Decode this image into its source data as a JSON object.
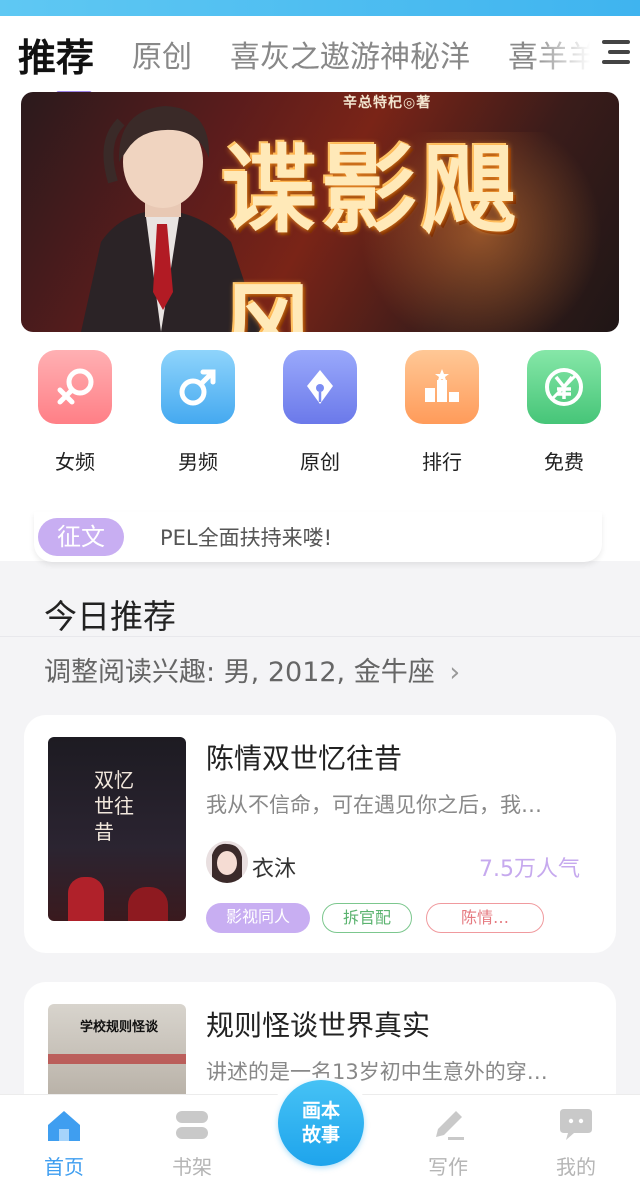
{
  "tabs": [
    {
      "label": "推荐",
      "active": true
    },
    {
      "label": "原创",
      "active": false
    },
    {
      "label": "喜灰之遨游神秘洋",
      "active": false
    },
    {
      "label": "喜羊羊",
      "active": false
    }
  ],
  "banner": {
    "author": "辛总特杞◎著",
    "title": "谍影飓风",
    "slide_count": 5,
    "active_slide": 1
  },
  "categories": [
    {
      "label": "女频",
      "icon": "female-symbol-icon",
      "color": "#ff8f93"
    },
    {
      "label": "男频",
      "icon": "male-symbol-icon",
      "color": "#54b8f3"
    },
    {
      "label": "原创",
      "icon": "pen-nib-icon",
      "color": "#7b8cf2"
    },
    {
      "label": "排行",
      "icon": "podium-icon",
      "color": "#ffb074"
    },
    {
      "label": "免费",
      "icon": "yen-free-icon",
      "color": "#5fd48d"
    }
  ],
  "notice": {
    "badge": "征文",
    "text": "PEL全面扶持来喽!"
  },
  "section": {
    "title": "今日推荐",
    "preferences": "调整阅读兴趣: 男, 2012, 金牛座"
  },
  "books": [
    {
      "title": "陈情双世忆往昔",
      "description": "我从不信命，可在遇见你之后，我…",
      "author": "衣沐",
      "popularity": "7.5万人气",
      "cover_text": "双忆世往昔",
      "tags": [
        {
          "label": "影视同人",
          "style": "filled"
        },
        {
          "label": "拆官配",
          "style": "green"
        },
        {
          "label": "陈情…",
          "style": "red"
        }
      ]
    },
    {
      "title": "规则怪谈世界真实",
      "description": "讲述的是一名13岁初中生意外的穿…",
      "cover_text": "学校规则怪谈"
    }
  ],
  "bottom_nav": {
    "items": [
      {
        "label": "首页",
        "icon": "home-icon",
        "active": true
      },
      {
        "label": "书架",
        "icon": "bookshelf-icon",
        "active": false
      },
      {
        "label": "写作",
        "icon": "write-pen-icon",
        "active": false
      },
      {
        "label": "我的",
        "icon": "profile-chat-icon",
        "active": false
      }
    ],
    "center_label": "画本故事"
  },
  "colors": {
    "accent_purple": "#9c82e6",
    "accent_blue": "#3f9ef0",
    "popularity": "#c6a9ee"
  }
}
